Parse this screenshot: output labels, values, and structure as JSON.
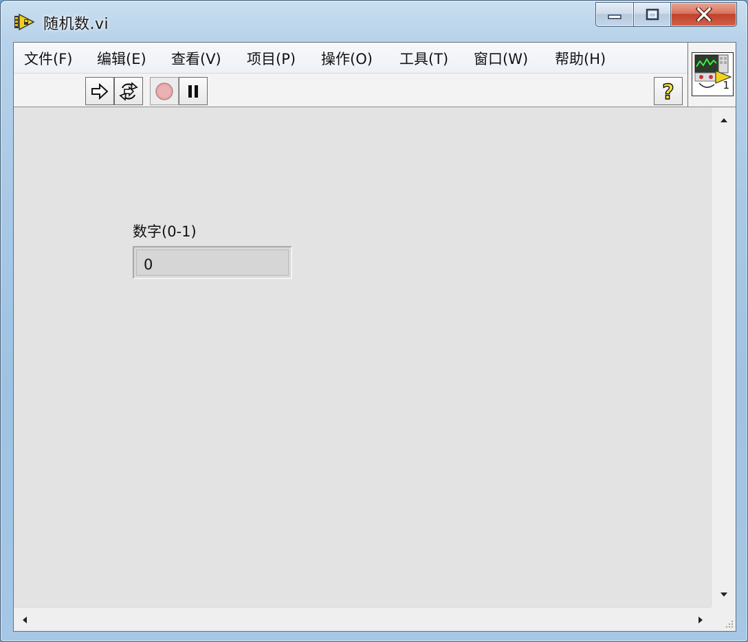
{
  "window": {
    "title": "随机数.vi",
    "icon": "labview-vi-icon",
    "caption_buttons": [
      "minimize-icon",
      "maximize-icon",
      "close-icon"
    ]
  },
  "menubar": {
    "items": [
      {
        "label": "文件(F)"
      },
      {
        "label": "编辑(E)"
      },
      {
        "label": "查看(V)"
      },
      {
        "label": "项目(P)"
      },
      {
        "label": "操作(O)"
      },
      {
        "label": "工具(T)"
      },
      {
        "label": "窗口(W)"
      },
      {
        "label": "帮助(H)"
      }
    ]
  },
  "toolbar": {
    "run_icon": "run-arrow-icon",
    "run_continuously_icon": "run-continuously-icon",
    "abort_icon": "abort-stop-icon",
    "pause_icon": "pause-icon",
    "help_icon": "context-help-icon",
    "help_glyph": "?"
  },
  "vi_icon": {
    "icon": "vi-connector-icon",
    "badge": "1"
  },
  "front_panel": {
    "numeric_indicator": {
      "label": "数字(0-1)",
      "value": "0"
    }
  },
  "colors": {
    "panel_background": "#e3e3e3",
    "close_button": "#c0422a",
    "help_glyph": "#f2e23a"
  }
}
